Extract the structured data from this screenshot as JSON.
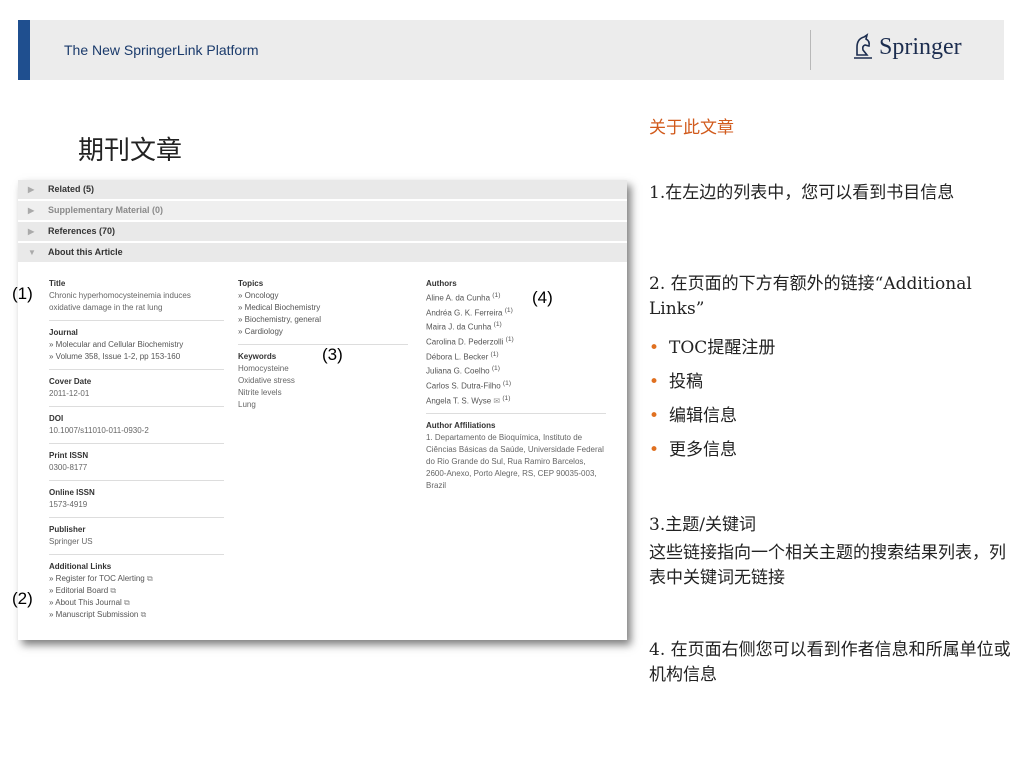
{
  "header": {
    "title": "The New SpringerLink Platform",
    "logo_text": "Springer",
    "accent_color": "#1f4f8f"
  },
  "page_title": "期刊文章",
  "screenshot": {
    "accordion": [
      {
        "label": "Related (5)",
        "muted": false
      },
      {
        "label": "Supplementary Material (0)",
        "muted": true
      },
      {
        "label": "References (70)",
        "muted": false
      },
      {
        "label": "About this Article",
        "muted": false
      }
    ],
    "left_column": {
      "title_label": "Title",
      "title_value": "Chronic hyperhomocysteinemia induces oxidative damage in the rat lung",
      "journal_label": "Journal",
      "journal_name": "» Molecular and Cellular Biochemistry",
      "journal_volume": "» Volume 358, Issue 1-2, pp 153-160",
      "cover_date_label": "Cover Date",
      "cover_date_value": "2011-12-01",
      "doi_label": "DOI",
      "doi_value": "10.1007/s11010-011-0930-2",
      "print_issn_label": "Print ISSN",
      "print_issn_value": "0300-8177",
      "online_issn_label": "Online ISSN",
      "online_issn_value": "1573-4919",
      "publisher_label": "Publisher",
      "publisher_value": "Springer US",
      "additional_links_label": "Additional Links",
      "additional_links": [
        "» Register for TOC Alerting",
        "» Editorial Board",
        "» About This Journal",
        "» Manuscript Submission"
      ]
    },
    "middle_column": {
      "topics_label": "Topics",
      "topics": [
        "» Oncology",
        "» Medical Biochemistry",
        "» Biochemistry, general",
        "» Cardiology"
      ],
      "keywords_label": "Keywords",
      "keywords": [
        "Homocysteine",
        "Oxidative stress",
        "Nitrite levels",
        "Lung"
      ]
    },
    "right_column": {
      "authors_label": "Authors",
      "authors": [
        "Aline A. da Cunha",
        "Andréa G. K. Ferreira",
        "Maira J. da Cunha",
        "Carolina D. Pederzolli",
        "Débora L. Becker",
        "Juliana G. Coelho",
        "Carlos S. Dutra-Filho",
        "Angela T. S. Wyse"
      ],
      "author_sup": "(1)",
      "affiliations_label": "Author Affiliations",
      "affiliation_text": "1. Departamento de Bioquímica, Instituto de Ciências Básicas da Saúde, Universidade Federal do Rio Grande do Sul, Rua Ramiro Barcelos, 2600-Anexo, Porto Alegre, RS, CEP 90035-003, Brazil"
    }
  },
  "callouts": {
    "c1": "(1)",
    "c2": "(2)",
    "c3": "(3)",
    "c4": "(4)"
  },
  "explanations": {
    "title": "关于此文章",
    "item1": "1.在左边的列表中，您可以看到书目信息",
    "item2_intro": "2. 在页面的下方有额外的链接“Additional Links”",
    "bullets": [
      "TOC提醒注册",
      "投稿",
      "编辑信息",
      "更多信息"
    ],
    "item3_title": "3.主题/关键词",
    "item3_body": "这些链接指向一个相关主题的搜索结果列表，列表中关键词无链接",
    "item4": "4. 在页面右侧您可以看到作者信息和所属单位或机构信息"
  }
}
